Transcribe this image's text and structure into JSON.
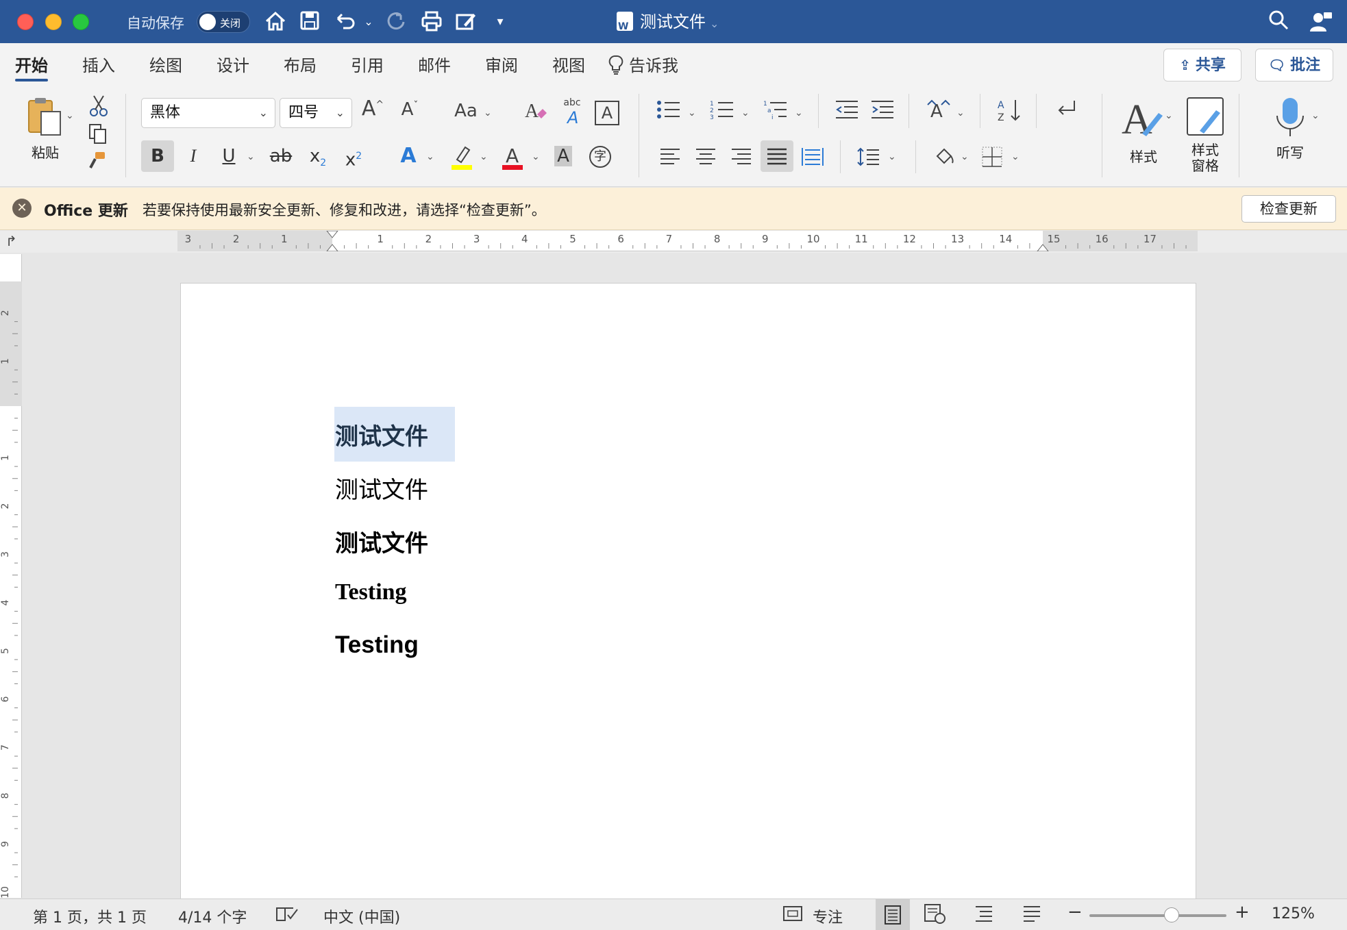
{
  "titlebar": {
    "autosave_label": "自动保存",
    "autosave_state": "关闭",
    "doc_title": "测试文件"
  },
  "tabs": {
    "items": [
      "开始",
      "插入",
      "绘图",
      "设计",
      "布局",
      "引用",
      "邮件",
      "审阅",
      "视图"
    ],
    "tell_me": "告诉我",
    "share": "共享",
    "comments": "批注"
  },
  "ribbon": {
    "paste_label": "粘贴",
    "font_name": "黑体",
    "font_size": "四号",
    "styles_label": "样式",
    "styles_pane_label_1": "样式",
    "styles_pane_label_2": "窗格",
    "dictate_label": "听写",
    "format_buttons": {
      "bold": "B",
      "italic": "I",
      "underline": "U",
      "strikethrough": "ab",
      "subscript": "x",
      "subscript_mark": "2",
      "superscript": "x",
      "superscript_mark": "2",
      "grow_font": "A",
      "shrink_font": "A",
      "change_case": "Aa",
      "abc": "abc",
      "enclose_char": "字",
      "shading_char": "A",
      "font_color_char": "A"
    }
  },
  "notification": {
    "title": "Office 更新",
    "message": "若要保持使用最新安全更新、修复和改进，请选择“检查更新”。",
    "button": "检查更新"
  },
  "ruler": {
    "h_labels_left": [
      "3",
      "2",
      "1"
    ],
    "h_labels_right": [
      "1",
      "2",
      "3",
      "4",
      "5",
      "6",
      "7",
      "8",
      "9",
      "10",
      "11",
      "12",
      "13",
      "14",
      "15",
      "16",
      "17"
    ],
    "v_labels_top": [
      "2",
      "1"
    ],
    "v_labels_body": [
      "1",
      "2",
      "3",
      "4",
      "5",
      "6",
      "7",
      "8",
      "9",
      "10"
    ]
  },
  "document": {
    "paragraphs": [
      {
        "text": "测试文件",
        "style": "heading-selected"
      },
      {
        "text": "测试文件",
        "style": "heading"
      },
      {
        "text": "测试文件",
        "style": "heading-bold"
      },
      {
        "text": "Testing",
        "style": "serif-bold"
      },
      {
        "text": "Testing",
        "style": "sans-bold"
      }
    ]
  },
  "status": {
    "page_info": "第 1 页，共 1 页",
    "word_count": "4/14 个字",
    "language": "中文 (中国)",
    "focus": "专注",
    "zoom": "125%",
    "zoom_fraction": 0.6
  },
  "colors": {
    "titlebar": "#2b5797",
    "selection": "#dbe7f7",
    "notification": "#fcf0d9",
    "highlight_yellow": "#ffff00",
    "font_red": "#e81123"
  }
}
